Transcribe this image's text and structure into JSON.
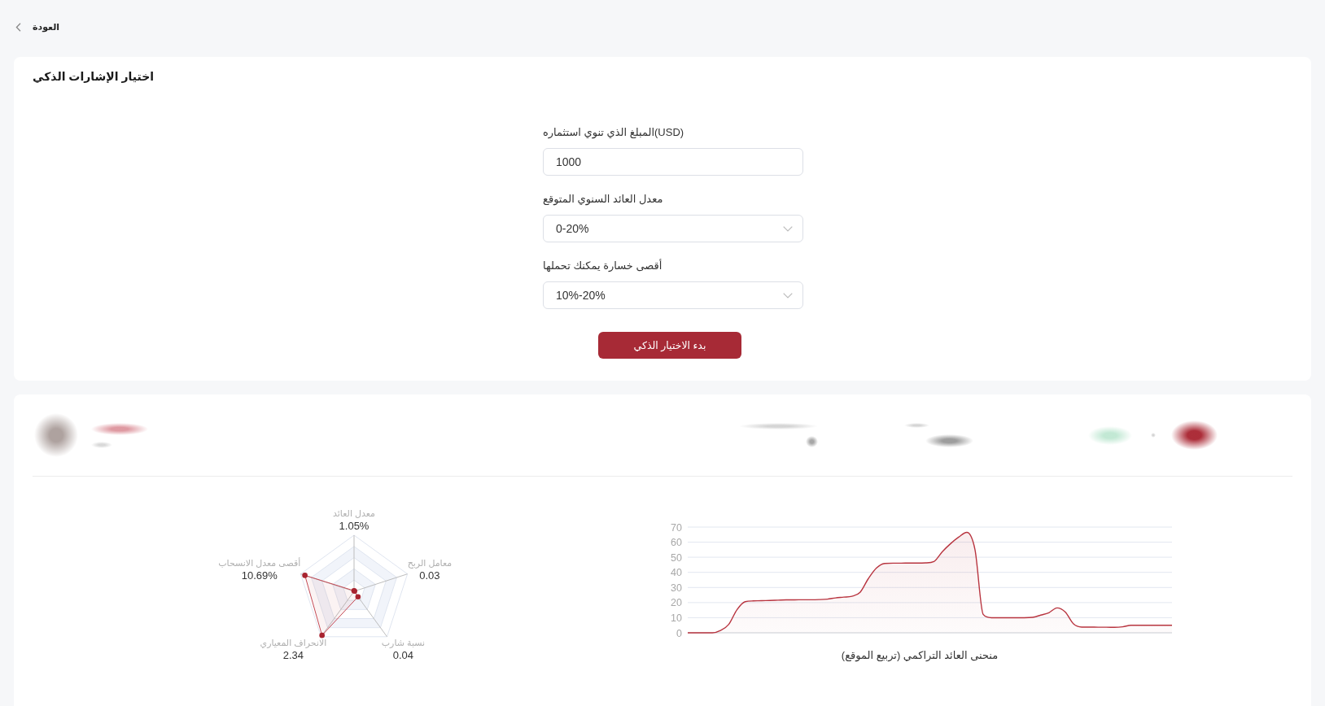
{
  "back_link": {
    "label": "العودة"
  },
  "selection_panel": {
    "title": "اختيار الإشارات الذكي",
    "fields": [
      {
        "kind": "input",
        "label": "المبلغ الذي تنوي استثماره(USD)",
        "value": "1000"
      },
      {
        "kind": "select",
        "label": "معدل العائد السنوي المتوقع",
        "value": "0-20%"
      },
      {
        "kind": "select",
        "label": "أقصى خسارة يمكنك تحملها",
        "value": "10%-20%"
      }
    ],
    "submit_button": "بدء الاختيار الذكي"
  },
  "result_panel": {
    "radar": {
      "indicators": [
        {
          "name": "معدل العائد",
          "value": "1.05%"
        },
        {
          "name": "معامل الربح",
          "value": "0.03"
        },
        {
          "name": "نسبة شارب",
          "value": "0.04"
        },
        {
          "name": "الانحراف المعياري",
          "value": "2.34"
        },
        {
          "name": "أقصى معدل الانسحاب",
          "value": "10.69%"
        }
      ]
    },
    "return_chart": {
      "chart_data": {
        "type": "area",
        "title": "منحنى العائد التراكمي (تربيع الموقع)",
        "grid": true,
        "ylim": [
          0,
          70
        ],
        "yticks": [
          0,
          10,
          20,
          30,
          40,
          50,
          60,
          70
        ],
        "series": [
          {
            "color": "#b8343f",
            "values": [
              0,
              0,
              0,
              0,
              1.5,
              5.6,
              15.3,
              20.6,
              21.1,
              21.3,
              21.4,
              21.6,
              21.8,
              21.8,
              21.9,
              21.9,
              22,
              22.3,
              23.1,
              23.6,
              24.2,
              26.8,
              35.8,
              42.9,
              45.9,
              46.1,
              46.1,
              46.2,
              46.2,
              46.3,
              47.2,
              53.6,
              58.9,
              63.3,
              66.5,
              55,
              12.2,
              10,
              10,
              10,
              10,
              10,
              10.2,
              11.7,
              13.3,
              16.5,
              13.7,
              5.9,
              3.8,
              3.8,
              3.7,
              3.7,
              3.6,
              4,
              5,
              5,
              5,
              5,
              5,
              5
            ]
          }
        ]
      }
    }
  }
}
